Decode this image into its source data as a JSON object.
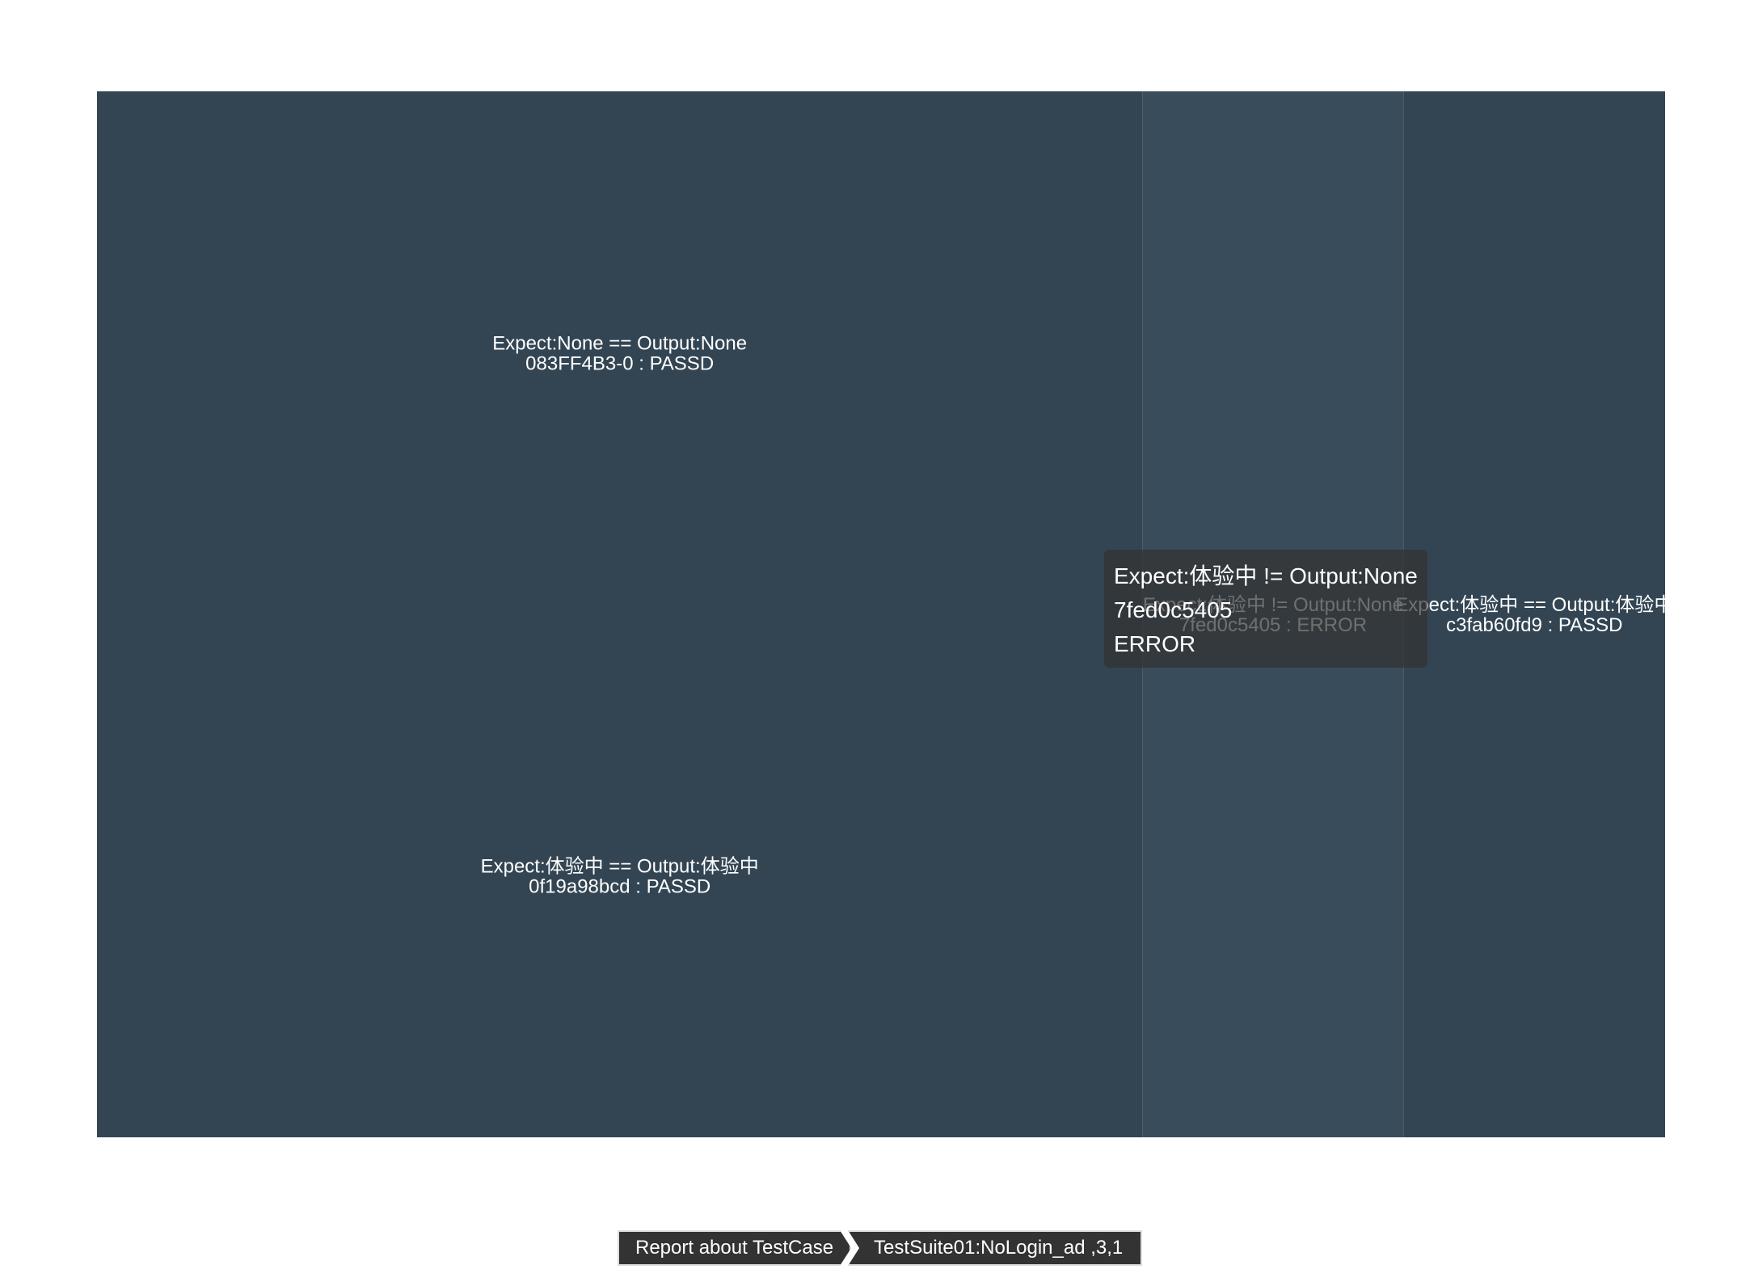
{
  "chart_data": {
    "type": "treemap",
    "nodes": [
      {
        "id": "node-0",
        "name": "083FF4B3-0",
        "line1": "Expect:None == Output:None",
        "line2": "083FF4B3-0 : PASSD",
        "value": 1,
        "color": "#334553"
      },
      {
        "id": "node-1",
        "name": "0f19a98bcd",
        "line1": "Expect:体验中 == Output:体验中",
        "line2": "0f19a98bcd : PASSD",
        "value": 1,
        "color": "#334553"
      },
      {
        "id": "node-2",
        "name": "7fed0c5405",
        "line1": "Expect:体验中 != Output:None",
        "line2": "7fed0c5405 : ERROR",
        "value": 0.5,
        "color": "#394c5b"
      },
      {
        "id": "node-3",
        "name": "c3fab60fd9",
        "line1": "Expect:体验中 == Output:体验中",
        "line2": "c3fab60fd9 : PASSD",
        "value": 0.5,
        "color": "#334553"
      }
    ]
  },
  "tooltip": {
    "line1": "Expect:体验中 != Output:None",
    "line2": "7fed0c5405",
    "line3": "ERROR"
  },
  "breadcrumb": {
    "root": "Report about TestCase",
    "current": "TestSuite01:NoLogin_ad ,3,1"
  }
}
